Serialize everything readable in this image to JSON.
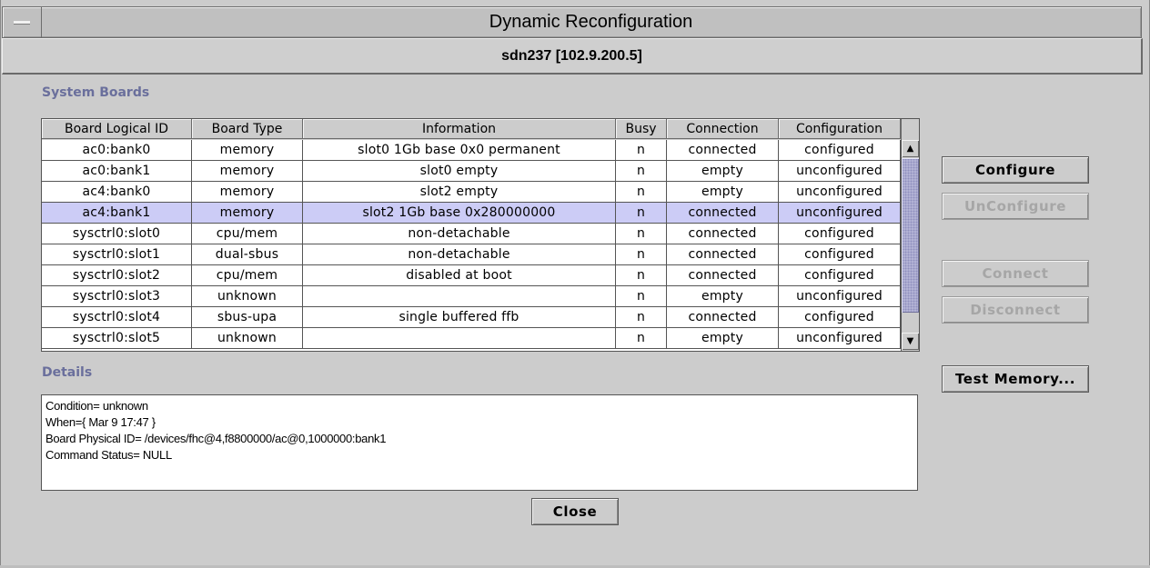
{
  "window": {
    "title": "Dynamic Reconfiguration",
    "subtitle": "sdn237 [102.9.200.5]"
  },
  "system_boards": {
    "label": "System Boards",
    "columns": [
      "Board Logical ID",
      "Board Type",
      "Information",
      "Busy",
      "Connection",
      "Configuration"
    ],
    "rows": [
      [
        "ac0:bank0",
        "memory",
        "slot0 1Gb base 0x0 permanent",
        "n",
        "connected",
        "configured"
      ],
      [
        "ac0:bank1",
        "memory",
        "slot0 empty",
        "n",
        "empty",
        "unconfigured"
      ],
      [
        "ac4:bank0",
        "memory",
        "slot2 empty",
        "n",
        "empty",
        "unconfigured"
      ],
      [
        "ac4:bank1",
        "memory",
        "slot2 1Gb base 0x280000000",
        "n",
        "connected",
        "unconfigured"
      ],
      [
        "sysctrl0:slot0",
        "cpu/mem",
        "non-detachable",
        "n",
        "connected",
        "configured"
      ],
      [
        "sysctrl0:slot1",
        "dual-sbus",
        "non-detachable",
        "n",
        "connected",
        "configured"
      ],
      [
        "sysctrl0:slot2",
        "cpu/mem",
        "disabled at boot",
        "n",
        "connected",
        "configured"
      ],
      [
        "sysctrl0:slot3",
        "unknown",
        "",
        "n",
        "empty",
        "unconfigured"
      ],
      [
        "sysctrl0:slot4",
        "sbus-upa",
        "single buffered ffb",
        "n",
        "connected",
        "configured"
      ],
      [
        "sysctrl0:slot5",
        "unknown",
        "",
        "n",
        "empty",
        "unconfigured"
      ]
    ],
    "selected_row": 3
  },
  "details": {
    "label": "Details",
    "lines": [
      "Condition= unknown",
      "When={ Mar 9 17:47 }",
      "Board Physical ID= /devices/fhc@4,f8800000/ac@0,1000000:bank1",
      "Command Status= NULL"
    ]
  },
  "buttons": {
    "configure": "Configure",
    "unconfigure": "UnConfigure",
    "connect": "Connect",
    "disconnect": "Disconnect",
    "test_memory": "Test Memory...",
    "close": "Close"
  },
  "colors": {
    "selection": "#ccccf6",
    "section_label": "#6a6f9c",
    "scroll_thumb": "#b4b4d6"
  }
}
